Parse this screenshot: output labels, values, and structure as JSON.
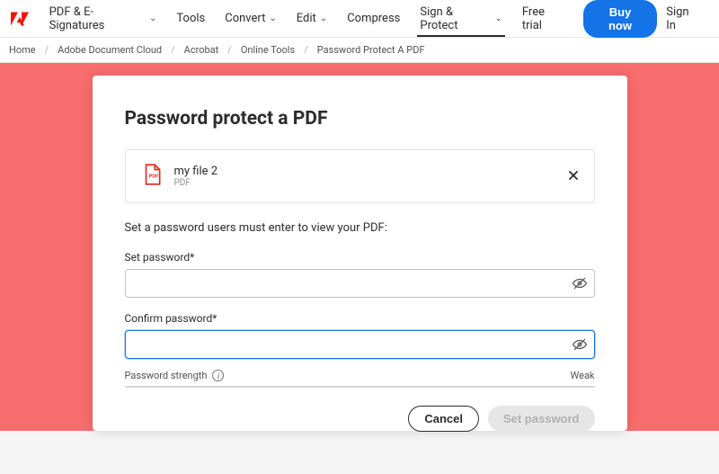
{
  "nav": {
    "items": [
      {
        "label": "PDF & E-Signatures",
        "chevron": true
      },
      {
        "label": "Tools",
        "chevron": false
      },
      {
        "label": "Convert",
        "chevron": true
      },
      {
        "label": "Edit",
        "chevron": true
      },
      {
        "label": "Compress",
        "chevron": false
      },
      {
        "label": "Sign & Protect",
        "chevron": true,
        "active": true
      },
      {
        "label": "Free trial",
        "chevron": false
      }
    ],
    "buy": "Buy now",
    "signin": "Sign In"
  },
  "breadcrumb": [
    "Home",
    "Adobe Document Cloud",
    "Acrobat",
    "Online Tools",
    "Password Protect A PDF"
  ],
  "card": {
    "title": "Password protect a PDF",
    "file": {
      "name": "my file 2",
      "type": "PDF"
    },
    "instruction": "Set a password users must enter to view your PDF:",
    "set_label": "Set password*",
    "confirm_label": "Confirm password*",
    "strength_label": "Password strength",
    "strength_value": "Weak",
    "cancel": "Cancel",
    "submit": "Set password"
  },
  "colors": {
    "accent": "#1473e6",
    "hero_bg": "#f76c6c",
    "adobe_red": "#fa0f00"
  }
}
